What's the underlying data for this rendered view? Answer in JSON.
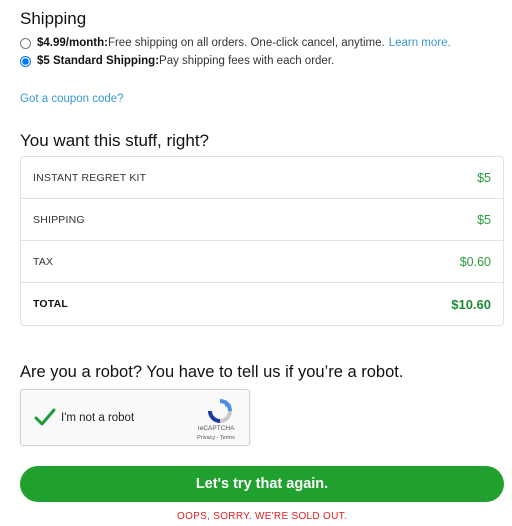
{
  "shipping": {
    "title": "Shipping",
    "options": [
      {
        "price_label": "$4.99/month:",
        "description": " Free shipping on all orders. One-click cancel, anytime.",
        "link": "Learn more.",
        "selected": false
      },
      {
        "price_label": "$5 Standard Shipping:",
        "description": " Pay shipping fees with each order.",
        "selected": true
      }
    ]
  },
  "coupon_link": "Got a coupon code?",
  "summary": {
    "title": "You want this stuff, right?",
    "rows": [
      {
        "label": "INSTANT REGRET KIT",
        "value": "$5"
      },
      {
        "label": "SHIPPING",
        "value": "$5"
      },
      {
        "label": "TAX",
        "value": "$0.60"
      },
      {
        "label": "TOTAL",
        "value": "$10.60"
      }
    ]
  },
  "robot": {
    "title": "Are you a robot? You have to tell us if you’re a robot.",
    "captcha_label": "I'm not a robot",
    "captcha_brand": "reCAPTCHA",
    "captcha_terms": "Privacy - Terms",
    "checked": true
  },
  "cta_label": "Let's try that again.",
  "error_message": "OOPS, SORRY. WE'RE SOLD OUT.",
  "colors": {
    "accent_green": "#20a02f",
    "link_blue": "#3a97d4",
    "error_red": "#e02020"
  }
}
